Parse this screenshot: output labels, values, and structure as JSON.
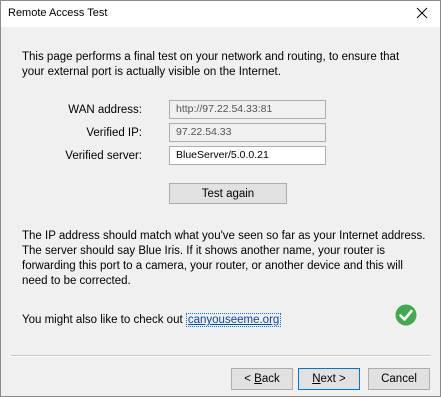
{
  "window": {
    "title": "Remote Access Test"
  },
  "intro_text": "This page performs a final test on your network and routing, to ensure that your external port is actually visible on the Internet.",
  "fields": [
    {
      "label": "WAN address:",
      "value": "http://97.22.54.33:81"
    },
    {
      "label": "Verified IP:",
      "value": "97.22.54.33"
    },
    {
      "label": "Verified server:",
      "value": "BlueServer/5.0.0.21"
    }
  ],
  "test_again_label": "Test again",
  "note_text": "The IP address should match what you've seen so far as your Internet address.  The server should say Blue Iris.  If it shows another name, your router is forwarding this port to a camera, your router, or another device and this will need to be corrected.",
  "check_out": {
    "prefix": "You might also like to check out",
    "link_text": "canyouseeme.org"
  },
  "buttons": {
    "back_prefix": "< ",
    "back_accel": "B",
    "back_rest": "ack",
    "next_accel": "N",
    "next_rest": "ext >",
    "cancel": "Cancel"
  },
  "icons": {
    "close": "close-icon",
    "status": "check-circle-icon"
  },
  "colors": {
    "status_green": "#3fab4e",
    "link_blue": "#0645ad",
    "focus_blue": "#0078d7"
  }
}
